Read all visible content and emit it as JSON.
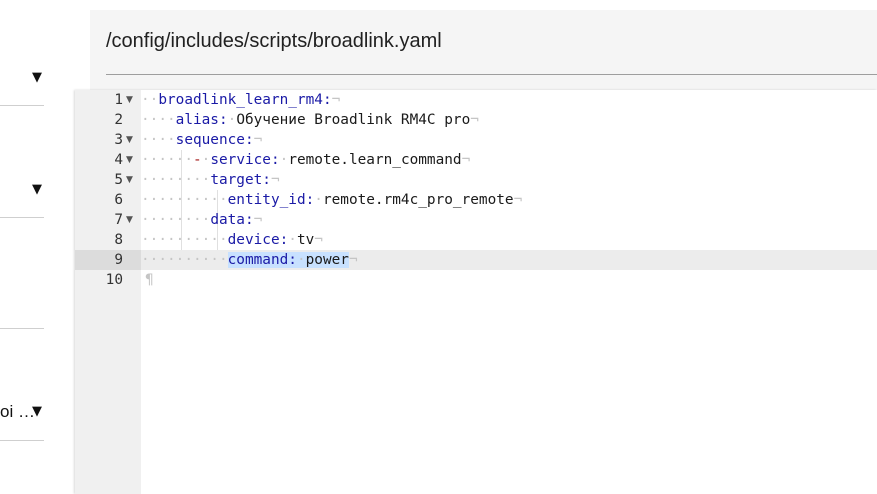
{
  "sidebar": {
    "items": [
      {
        "label": ""
      },
      {
        "label": ""
      },
      {
        "label": ""
      },
      {
        "label": "oi …"
      }
    ],
    "toggle_glyph": "▼"
  },
  "editor": {
    "file_path": "/config/includes/scripts/broadlink.yaml",
    "active_line": 9,
    "lines": [
      {
        "num": "1",
        "fold": "▼",
        "key": "broadlink_learn_rm4:",
        "value": ""
      },
      {
        "num": "2",
        "fold": "",
        "key": "alias:",
        "value": "Обучение Broadlink RM4C pro"
      },
      {
        "num": "3",
        "fold": "▼",
        "key": "sequence:",
        "value": ""
      },
      {
        "num": "4",
        "fold": "▼",
        "dash": "-",
        "key": "service:",
        "value": "remote.learn_command"
      },
      {
        "num": "5",
        "fold": "▼",
        "key": "target:",
        "value": ""
      },
      {
        "num": "6",
        "fold": "",
        "key": "entity_id:",
        "value": "remote.rm4c_pro_remote"
      },
      {
        "num": "7",
        "fold": "▼",
        "key": "data:",
        "value": ""
      },
      {
        "num": "8",
        "fold": "",
        "key": "device:",
        "value": "tv"
      },
      {
        "num": "9",
        "fold": "",
        "key": "command:",
        "value": "power"
      },
      {
        "num": "10",
        "fold": "",
        "key": "",
        "value": ""
      }
    ],
    "eol_glyph": "¬",
    "eof_glyph": "¶"
  }
}
